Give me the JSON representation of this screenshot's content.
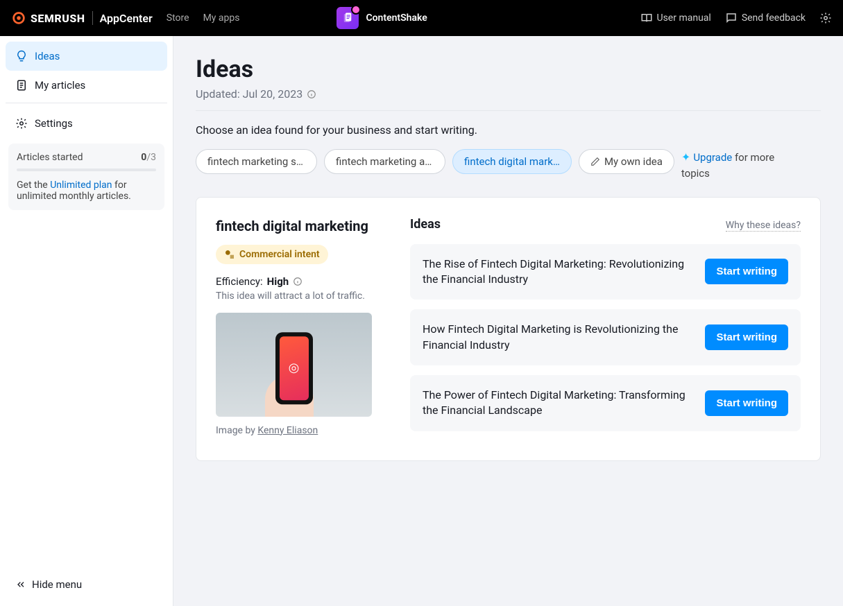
{
  "header": {
    "brand": "SEMRUSH",
    "appcenter": "AppCenter",
    "store": "Store",
    "myapps": "My apps",
    "app_name": "ContentShake",
    "user_manual": "User manual",
    "send_feedback": "Send feedback"
  },
  "sidebar": {
    "ideas": "Ideas",
    "articles": "My articles",
    "settings": "Settings",
    "quota_label": "Articles started",
    "quota_used": "0",
    "quota_total": "/3",
    "quota_text_a": "Get the ",
    "quota_link": "Unlimited plan",
    "quota_text_b": " for unlimited monthly articles.",
    "hide": "Hide menu"
  },
  "main": {
    "title": "Ideas",
    "updated": "Updated: Jul 20, 2023",
    "subtitle": "Choose an idea found for your business and start writing.",
    "pills": [
      "fintech marketing str…",
      "fintech marketing age…",
      "fintech digital mark…"
    ],
    "own_idea": "My own idea",
    "upgrade_link": "Upgrade",
    "upgrade_text": " for more topics",
    "topic_title": "fintech digital marketing",
    "intent": "Commercial intent",
    "efficiency_label": "Efficiency: ",
    "efficiency_value": "High",
    "efficiency_desc": "This idea will attract a lot of traffic.",
    "image_by": "Image by ",
    "image_author": "Kenny Eliason",
    "ideas_heading": "Ideas",
    "why": "Why these ideas?",
    "ideas": [
      "The Rise of Fintech Digital Marketing: Revolutionizing the Financial Industry",
      "How Fintech Digital Marketing is Revolutionizing the Financial Industry",
      "The Power of Fintech Digital Marketing: Transforming the Financial Landscape"
    ],
    "start_writing": "Start writing"
  }
}
